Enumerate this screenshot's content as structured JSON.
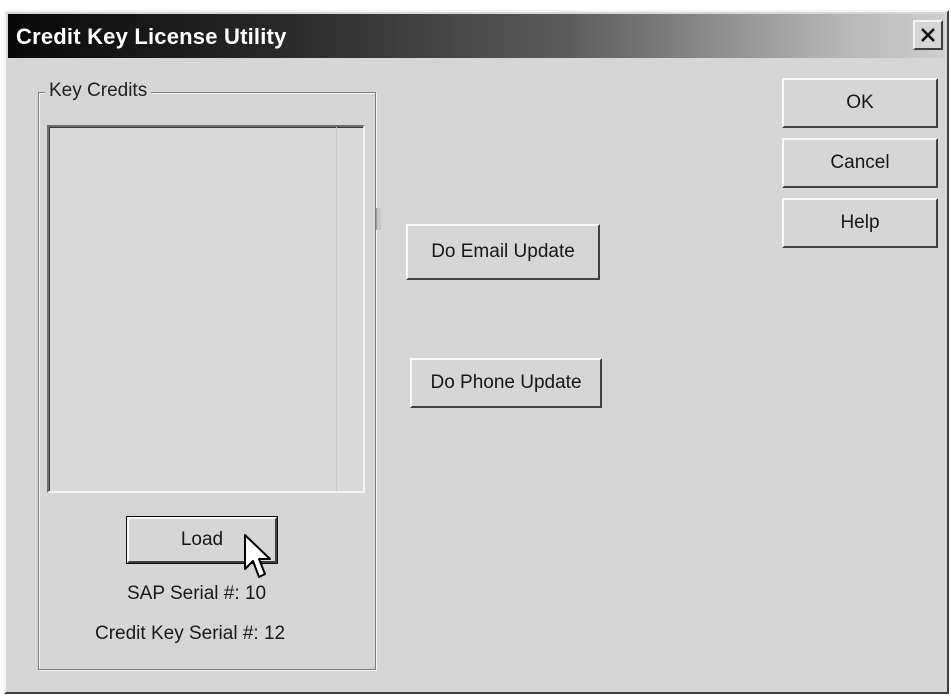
{
  "window": {
    "title": "Credit Key License Utility",
    "close_glyph": "✕"
  },
  "key_credits": {
    "group_label": "Key Credits",
    "load_label": "Load",
    "sap_serial_label": "SAP Serial #:",
    "sap_serial_value": "10",
    "credit_key_serial_label": "Credit Key Serial #:",
    "credit_key_serial_value": "12"
  },
  "actions": {
    "email_update_label": "Do Email Update",
    "phone_update_label": "Do Phone Update"
  },
  "dialog_buttons": {
    "ok_label": "OK",
    "cancel_label": "Cancel",
    "help_label": "Help"
  },
  "icons": {
    "close": "close-icon",
    "cursor": "mouse-pointer-icon"
  },
  "colors": {
    "dialog_face": "#d6d6d6",
    "title_start": "#080808",
    "title_end": "#cfcfcf",
    "title_text": "#ffffff"
  }
}
